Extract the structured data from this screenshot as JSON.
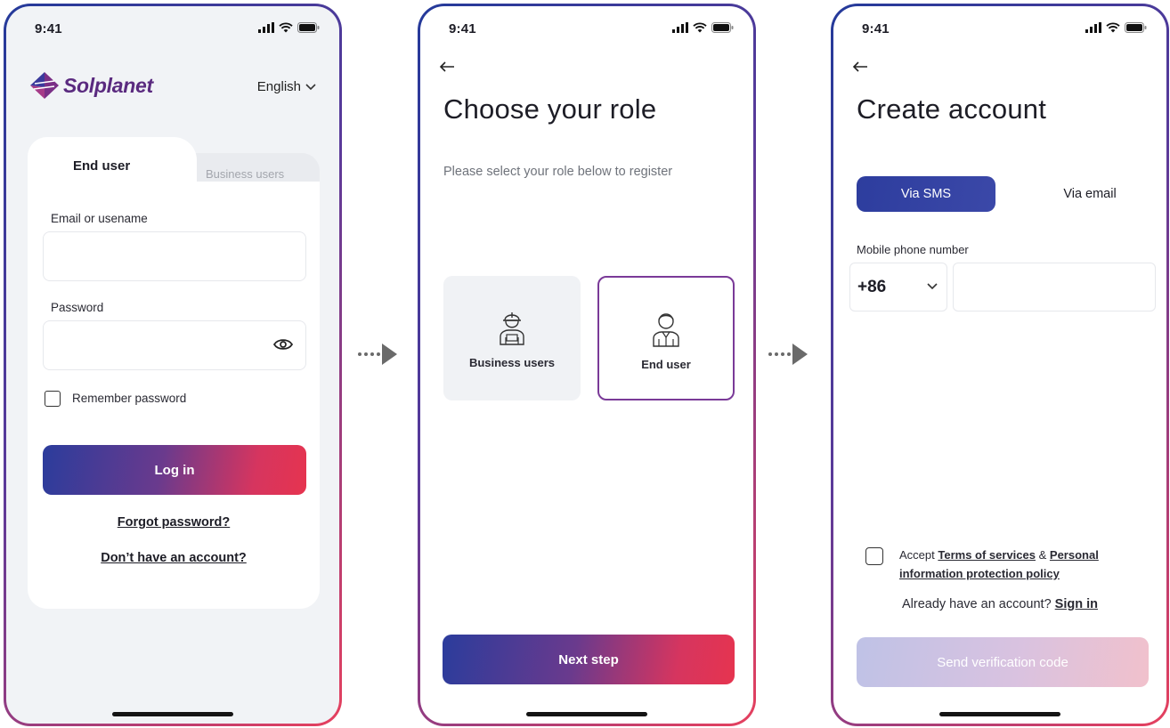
{
  "status_bar": {
    "time": "9:41"
  },
  "login_screen": {
    "brand": "Solplanet",
    "language": "English",
    "tabs": {
      "active": "End user",
      "inactive": "Business users"
    },
    "email_label": "Email or usename",
    "email_value": "",
    "password_label": "Password",
    "password_value": "",
    "remember_label": "Remember password",
    "login_button": "Log in",
    "forgot_link": "Forgot password?",
    "register_link": "Don’t have an account?"
  },
  "role_screen": {
    "title": "Choose your role",
    "subtitle": "Please select your role below to register",
    "roles": [
      {
        "label": "Business users",
        "icon": "construction-worker-icon",
        "selected": false
      },
      {
        "label": "End user",
        "icon": "user-person-icon",
        "selected": true
      }
    ],
    "next_button": "Next step"
  },
  "create_account_screen": {
    "title": "Create account",
    "tabs": {
      "active": "Via SMS",
      "inactive": "Via email"
    },
    "phone_label": "Mobile phone number",
    "country_code": "+86",
    "phone_value": "",
    "terms_prefix": "Accept",
    "terms_link": "Terms of services",
    "terms_and": "&",
    "privacy_link_1": "Personal",
    "privacy_link_2": "information protection policy",
    "signin_prompt": "Already have an account?",
    "signin_link": "Sign in",
    "send_button": "Send verification code"
  },
  "colors": {
    "brand_purple": "#5a2a7f",
    "gradient_start": "#2b3c9c",
    "gradient_end": "#e6344f",
    "selected_border": "#7a3a98"
  }
}
